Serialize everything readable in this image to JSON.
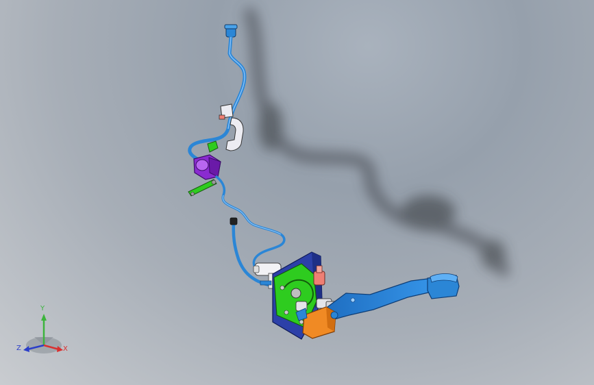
{
  "scene": {
    "background_top": "#96a0ac",
    "background_bottom": "#c9ccd0",
    "model_parts": [
      {
        "name": "clutch-hose",
        "color": "#2b86d6"
      },
      {
        "name": "reservoir-bracket",
        "color": "#e9e9ee"
      },
      {
        "name": "master-cylinder",
        "color": "#8a2bd0"
      },
      {
        "name": "mount-bracket",
        "color": "#2ecc1f"
      },
      {
        "name": "pedal-bracket",
        "color": "#2c40a8"
      },
      {
        "name": "pedal-arm",
        "color": "#2b86d6"
      },
      {
        "name": "switch-block",
        "color": "#f08a24"
      },
      {
        "name": "pedal-stop",
        "color": "#ef7f74"
      }
    ]
  },
  "triad": {
    "y_label": "Y",
    "z_label": "Z",
    "x_label": "X",
    "y_color": "#3cb43c",
    "z_color": "#2b3ec9",
    "x_color": "#d93030"
  }
}
